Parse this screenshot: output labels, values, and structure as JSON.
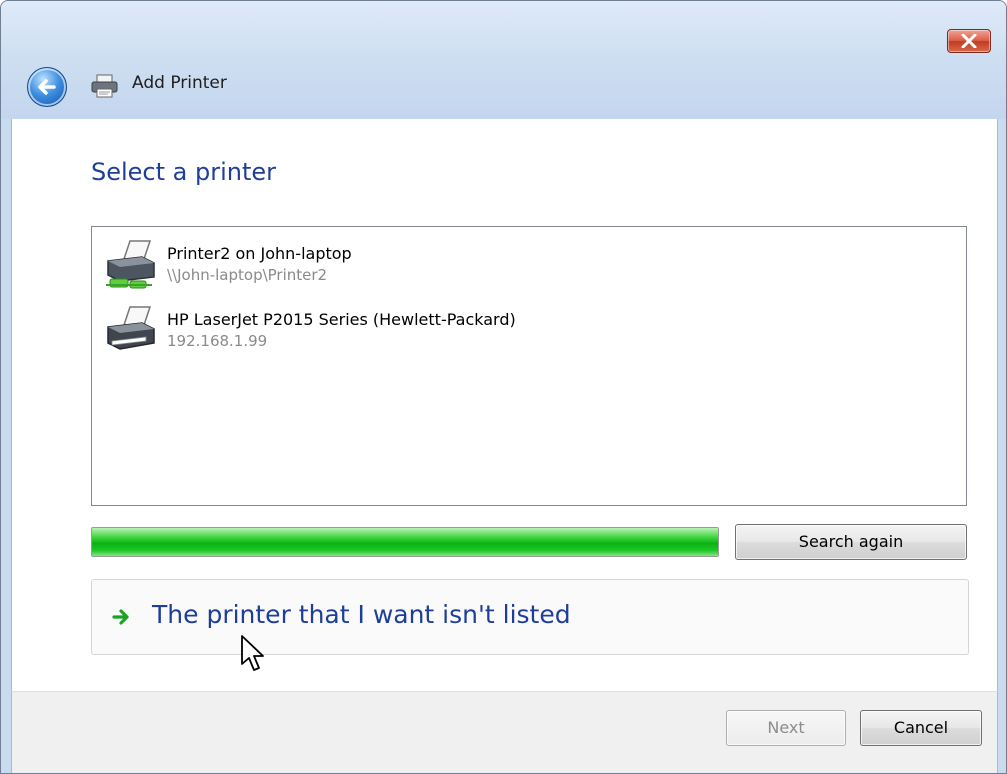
{
  "window": {
    "title": "Add Printer",
    "close_glyph": "✕"
  },
  "heading": "Select a printer",
  "printers": [
    {
      "name": "Printer2 on John-laptop",
      "address": "\\\\John-laptop\\Printer2",
      "icon": "shared-printer-icon"
    },
    {
      "name": "HP LaserJet P2015 Series (Hewlett-Packard)",
      "address": "192.168.1.99",
      "icon": "printer-icon"
    }
  ],
  "search": {
    "progress_percent": 100,
    "button_label": "Search again"
  },
  "not_listed_link": "The printer that I want isn't listed",
  "footer": {
    "next_label": "Next",
    "cancel_label": "Cancel"
  },
  "colors": {
    "heading": "#1f3e99",
    "progress": "#08b412",
    "link_arrow": "#1aa51e"
  }
}
